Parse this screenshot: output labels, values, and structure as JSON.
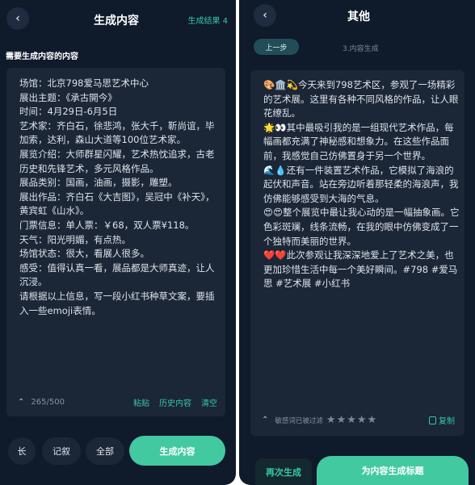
{
  "left": {
    "header": {
      "back_icon": "‹",
      "title": "生成内容",
      "result_count": "生成结果 4"
    },
    "section_label": "需要生成内容的内容",
    "input_text": "场馆：北京798爱马思艺术中心\n展出主题：《承古開今》\n时间：4月29日-6月5日\n艺术家：齐白石，徐悲鸿，张大千，靳尚谊，毕加索，达利，森山大道等100位艺术家。\n展览介绍：大师群星闪耀，艺术热忱追求，古老历史和先锋艺术，多元风格作品。\n展品类别：国画，油画，摄影，雕塑。\n展出作品：齐白石《大吉图》，吴冠中《补天》，黄宾虹《山水》。\n门票信息：单人票：￥68，双人票¥118。\n天气：阳光明媚，有点热。\n场馆状态：很大，看展人很多。\n感受：值得认真一看，展品都是大师真迹，让人沉浸。\n请根据以上信息，写一段小红书种草文案，要插入一些emoji表情。",
    "footer": {
      "collapse_icon": "⌃",
      "char_count": "265/500",
      "paste": "粘贴",
      "history": "历史内容",
      "clear": "清空"
    },
    "bottom": {
      "chip_long": "长",
      "chip_narrative": "记叙",
      "chip_all": "全部",
      "generate": "生成内容"
    }
  },
  "right": {
    "header": {
      "back_icon": "‹",
      "title": "其他"
    },
    "prev_step": "上一步",
    "step_label": "3.内容生成",
    "result_text": "🎨🏛️💫今天来到798艺术区，参观了一场精彩的艺术展。这里有各种不同风格的作品，让人眼花缭乱。\n🌟👀其中最吸引我的是一组现代艺术作品，每幅画都充满了神秘感和想象力。在这些作品面前，我感觉自己仿佛置身于另一个世界。\n🌊💧还有一件装置艺术作品，它模拟了海浪的起伏和声音。站在旁边听着那轻柔的海浪声，我仿佛能够感受到大海的气息。\n😍😍整个展览中最让我心动的是一幅抽象画。它色彩斑斓，线条流畅，在我的眼中仿佛变成了一个独特而美丽的世界。\n❤️❤️此次参观让我深深地爱上了艺术之美，也更加珍惜生活中每一个美好瞬间。#798 #爱马思 #艺术展 #小红书",
    "footer": {
      "collapse_icon": "⌃",
      "filter_note": "敏感词已被过滤",
      "star_icon": "★",
      "rating": 0,
      "copy": "复制"
    },
    "bottom": {
      "regenerate": "再次生成",
      "generate_title": "为内容生成标题"
    }
  },
  "colors": {
    "background": "#0f1a2b",
    "card": "#1b2637",
    "accent": "#42c9a0",
    "accent_text": "#37c7a4"
  }
}
